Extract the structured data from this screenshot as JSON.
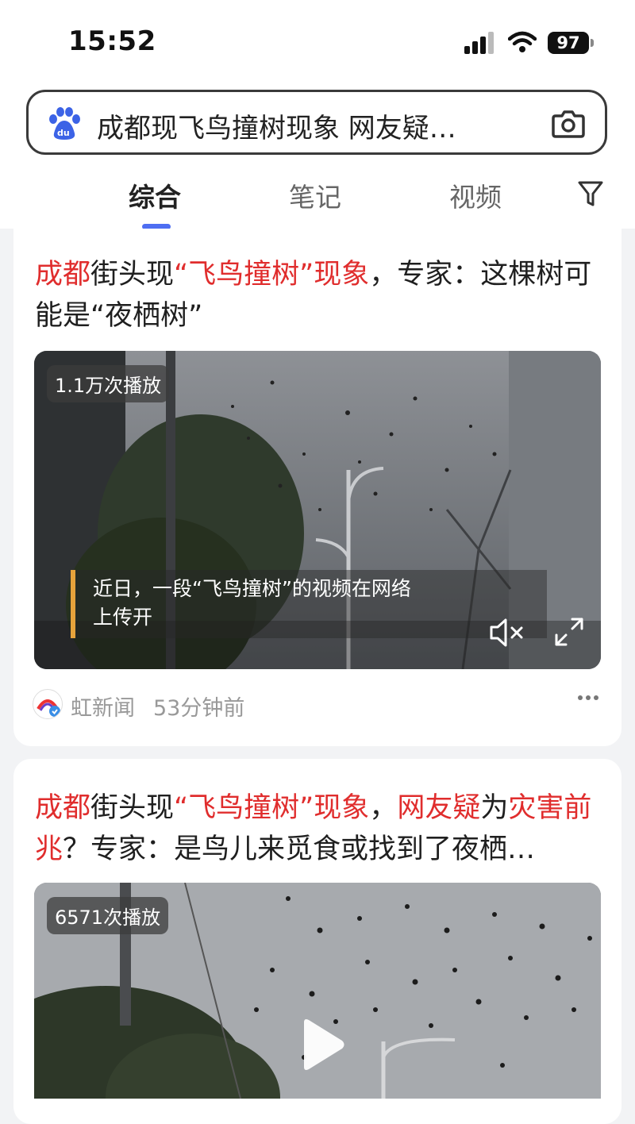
{
  "status_bar": {
    "time": "15:52",
    "battery": "97"
  },
  "search": {
    "query": "成都现飞鸟撞树现象 网友疑…"
  },
  "tabs": [
    {
      "label": "综合",
      "active": true
    },
    {
      "label": "笔记",
      "active": false
    },
    {
      "label": "视频",
      "active": false
    }
  ],
  "results": [
    {
      "title_parts": [
        {
          "text": "成都",
          "hl": true
        },
        {
          "text": "街头现",
          "hl": false
        },
        {
          "text": "“飞鸟撞树”现象",
          "hl": true
        },
        {
          "text": "，专家：这棵树可能是“夜栖树”",
          "hl": false
        }
      ],
      "plays": "1.1万次播放",
      "subtitle": "近日，一段“飞鸟撞树”的视频在网络上传开",
      "source": "虹新闻",
      "time_ago": "53分钟前"
    },
    {
      "title_parts": [
        {
          "text": "成都",
          "hl": true
        },
        {
          "text": "街头现",
          "hl": false
        },
        {
          "text": "“飞鸟撞树”现象",
          "hl": true
        },
        {
          "text": "，",
          "hl": false
        },
        {
          "text": "网友疑",
          "hl": true
        },
        {
          "text": "为",
          "hl": false
        },
        {
          "text": "灾害前兆",
          "hl": true
        },
        {
          "text": "？专家：是鸟儿来觅食或找到了夜栖…",
          "hl": false
        }
      ],
      "plays": "6571次播放"
    }
  ],
  "colors": {
    "highlight": "#e02d2d",
    "accent": "#4e6ef2",
    "subtitle_bar": "#e6a33b"
  }
}
